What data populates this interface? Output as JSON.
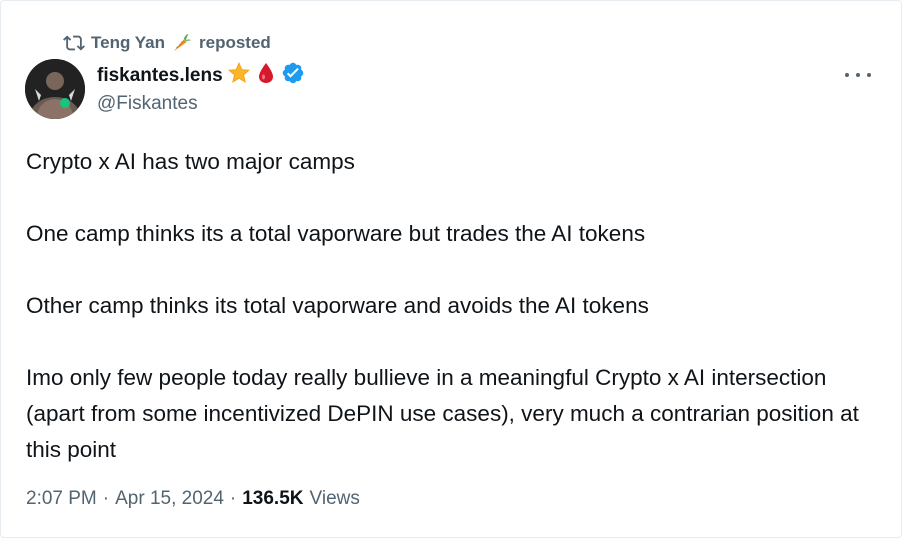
{
  "repost": {
    "user": "Teng Yan",
    "user_emoji_icon": "carrot-icon",
    "label": "reposted"
  },
  "author": {
    "display_name": "fiskantes.lens",
    "badges": [
      "star-icon",
      "blood-drop-icon",
      "verified-badge-icon"
    ],
    "handle": "@Fiskantes"
  },
  "tweet": {
    "paragraphs": [
      "Crypto x AI has two major camps",
      "One camp thinks its a total vaporware but trades the AI tokens",
      "Other camp thinks its total vaporware and avoids the AI tokens",
      "Imo only few people today really bullieve in a meaningful Crypto x AI intersection (apart from some incentivized DePIN use cases), very much a contrarian position at this point"
    ]
  },
  "meta": {
    "time": "2:07 PM",
    "date": "Apr 15, 2024",
    "separator": "·",
    "views_count": "136.5K",
    "views_label": "Views"
  },
  "colors": {
    "text": "#0f1419",
    "secondary": "#536471",
    "verified": "#1d9bf0"
  }
}
